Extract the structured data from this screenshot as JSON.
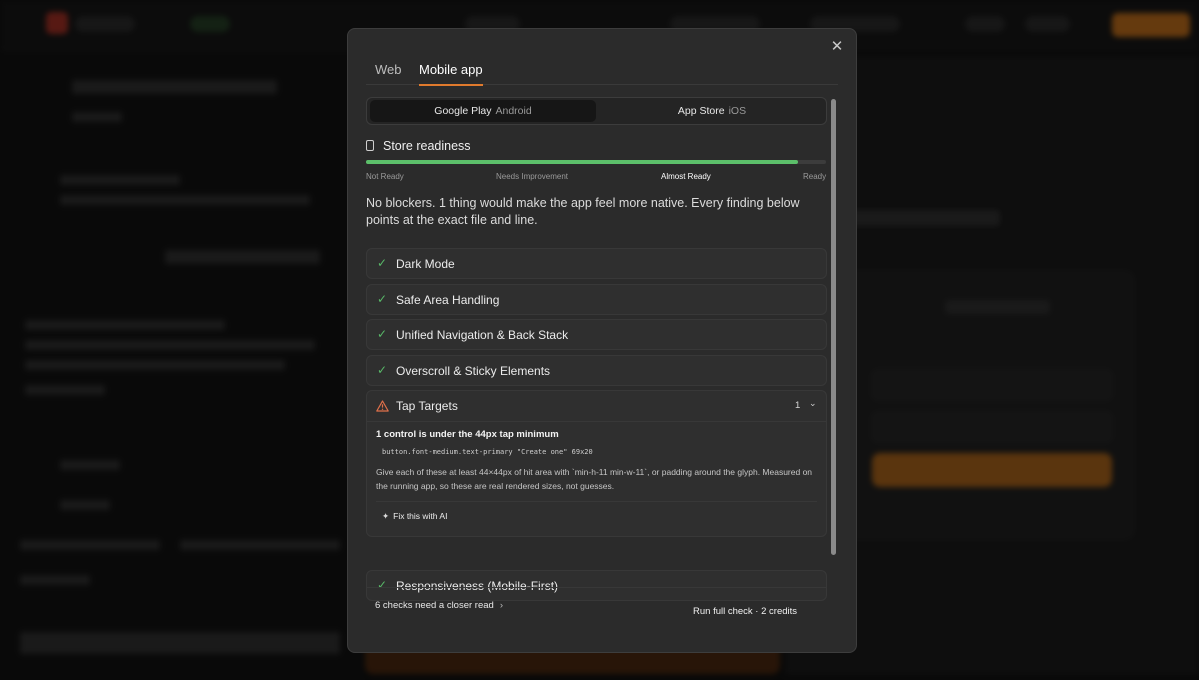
{
  "modal": {
    "tabs": [
      {
        "label": "Web",
        "active": false
      },
      {
        "label": "Mobile app",
        "active": true
      }
    ],
    "platforms": [
      {
        "name": "Google Play",
        "sub": "Android",
        "active": true
      },
      {
        "name": "App Store",
        "sub": "iOS",
        "active": false
      }
    ],
    "readiness": {
      "title": "Store readiness",
      "progress_percent": 94,
      "scale": [
        "Not Ready",
        "Needs Improvement",
        "Almost Ready",
        "Ready"
      ],
      "current": "Almost Ready"
    },
    "summary": "No blockers. 1 thing would make the app feel more native. Every finding below points at the exact file and line.",
    "checks_passed": [
      "Dark Mode",
      "Safe Area Handling",
      "Unified Navigation & Back Stack",
      "Overscroll & Sticky Elements"
    ],
    "tap_targets": {
      "label": "Tap Targets",
      "count": "1",
      "detail_title": "1 control is under the 44px tap minimum",
      "code": "button.font-medium.text-primary  \"Create one\"  69x20",
      "help": "Give each of these at least 44×44px of hit area with `min-h-11 min-w-11`, or padding around the glyph. Measured on the running app, so these are real rendered sizes, not guesses.",
      "fix_label": "Fix this with AI"
    },
    "check_after": "Responsiveness (Mobile-First)",
    "closer_read": "6 checks need a closer read",
    "run_full": "Run full check · 2 credits"
  },
  "colors": {
    "accent": "#e07a2d",
    "success": "#5cbf6a",
    "warning": "#e0704a"
  }
}
